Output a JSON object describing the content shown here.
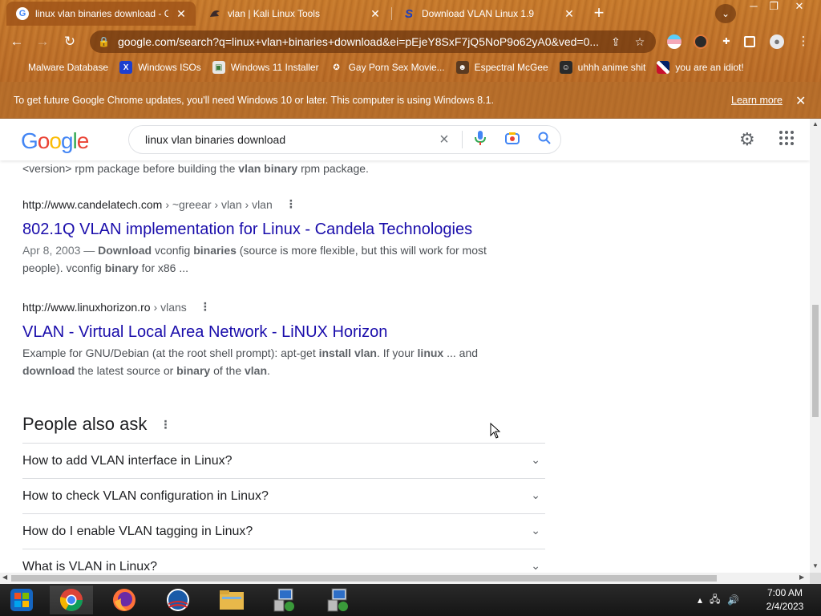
{
  "browser": {
    "tabs": [
      {
        "title": "linux vlan binaries download - Goo",
        "active": true,
        "favicon": "google-icon"
      },
      {
        "title": "vlan | Kali Linux Tools",
        "active": false,
        "favicon": "kali-dragon-icon"
      },
      {
        "title": "Download VLAN Linux 1.9",
        "active": false,
        "favicon": "softpedia-s-icon"
      }
    ],
    "new_tab": "+",
    "tab_close": "✕",
    "url": "google.com/search?q=linux+vlan+binaries+download&ei=pEjeY8SxF7jQ5NoP9o62yA0&ved=0...",
    "infobar": {
      "message": "To get future Google Chrome updates, you'll need Windows 10 or later. This computer is using Windows 8.1.",
      "link": "Learn more"
    },
    "bookmarks": [
      {
        "label": "Malware Database",
        "icon": "blank"
      },
      {
        "label": "Windows ISOs",
        "icon": "x-logo-icon"
      },
      {
        "label": "Windows 11 Installer",
        "icon": "image-icon"
      },
      {
        "label": "Gay Porn Sex Movie...",
        "icon": "emblem-icon"
      },
      {
        "label": "Espectral McGee",
        "icon": "avatar-icon"
      },
      {
        "label": "uhhh anime shit",
        "icon": "anime-icon"
      },
      {
        "label": "you are an idiot!",
        "icon": "flag-icon"
      }
    ]
  },
  "google": {
    "logo": [
      "G",
      "o",
      "o",
      "g",
      "l",
      "e"
    ],
    "query": "linux vlan binaries download"
  },
  "results": {
    "top_snippet": {
      "pre": "<version> rpm package before building the ",
      "b1": "vlan binary",
      "post": " rpm package."
    },
    "items": [
      {
        "cite_domain": "http://www.candelatech.com",
        "cite_path": "› ~greear › vlan › vlan",
        "title": "802.1Q VLAN implementation for Linux - Candela Technologies",
        "date": "Apr 8, 2003 — ",
        "d1": "Download",
        "d2": " vconfig ",
        "d3": "binaries",
        "d4": " (source is more flexible, but this will work for most people). vconfig ",
        "d5": "binary",
        "d6": " for x86 ..."
      },
      {
        "cite_domain": "http://www.linuxhorizon.ro",
        "cite_path": "› vlans",
        "title": "VLAN - Virtual Local Area Network - LiNUX Horizon",
        "e1": "Example for GNU/Debian (at the root shell prompt): apt-get ",
        "e2": "install vlan",
        "e3": ". If your ",
        "e4": "linux",
        "e5": " ... and ",
        "e6": "download",
        "e7": " the latest source or ",
        "e8": "binary",
        "e9": " of the ",
        "e10": "vlan",
        "e11": "."
      }
    ]
  },
  "people_also_ask": {
    "title": "People also ask",
    "questions": [
      "How to add VLAN interface in Linux?",
      "How to check VLAN configuration in Linux?",
      "How do I enable VLAN tagging in Linux?",
      "What is VLAN in Linux?"
    ]
  },
  "taskbar": {
    "clock_time": "7:00 AM",
    "clock_date": "2/4/2023"
  },
  "colors": {
    "link": "#1a0dab",
    "chrome_theme": "#c0722a"
  }
}
